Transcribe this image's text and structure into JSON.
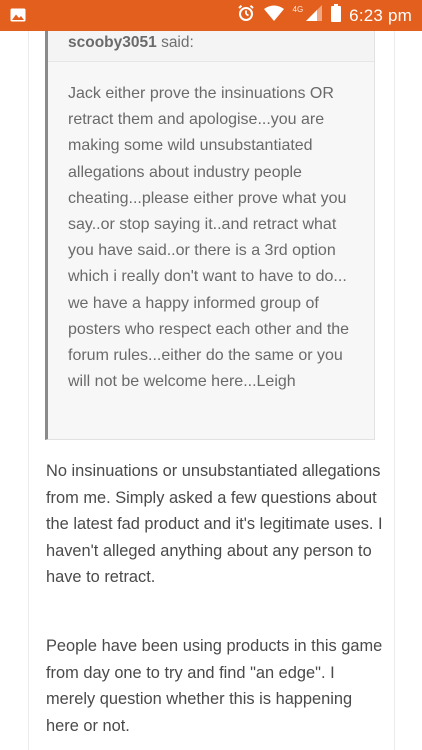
{
  "status_bar": {
    "network_label": "4G",
    "time": "6:23 pm",
    "icons": [
      "image-icon",
      "alarm-icon",
      "wifi-icon",
      "signal-icon",
      "battery-icon"
    ]
  },
  "quote": {
    "author": "scooby3051",
    "said_label": "said:",
    "text": "Jack either prove the insinuations OR retract them and apologise...you are making some wild unsubstantiated allegations  about industry people cheating...please either prove what you say..or stop saying it..and retract what you have said..or there is a 3rd option which i really don't want to have to do... we have a happy informed group of posters who respect each other and the forum rules...either do the same or you will not be welcome here...Leigh"
  },
  "post": {
    "paragraphs": [
      "No insinuations or unsubstantiated allegations from me. Simply asked a few questions about the latest fad product and it's legitimate uses. I haven't alleged anything about any person to have to retract.",
      "People have been using products in this game from day one to try and find \"an edge\". I merely question whether this is happening here or not."
    ]
  },
  "colors": {
    "status_bar": "#e35f1d",
    "quote_bg": "#f7f7f7",
    "quote_border": "#8a8a8a",
    "body_text": "#4a4a4a",
    "quote_text": "#6a6a6a"
  }
}
